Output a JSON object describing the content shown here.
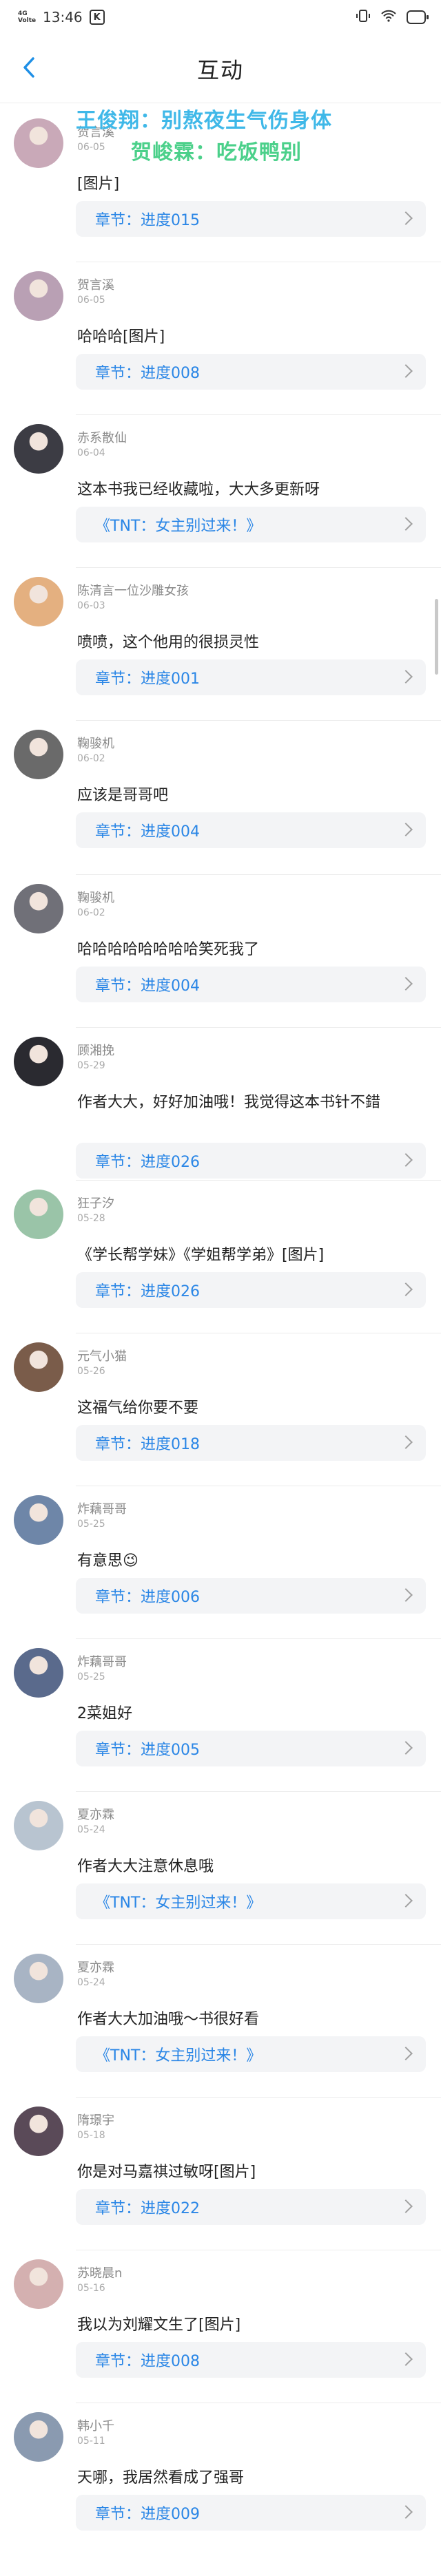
{
  "status_bar": {
    "time": "13:46",
    "net_badge": "4G\nVolte",
    "sq_badge": "K",
    "battery_icon": "battery-icon",
    "wifi_icon": "wifi-icon",
    "vibrate_icon": "vibrate-icon"
  },
  "header": {
    "title": "互动",
    "back_icon": "chevron-left-icon"
  },
  "overlay": {
    "line1": "王俊翔：别熬夜生气伤身体",
    "line2": "贺峻霖：吃饭鸭别"
  },
  "comments": [
    {
      "user": "贺言溪",
      "date": "06-05",
      "text": "[图片]",
      "chapter": "章节：进度015",
      "accent": "#2a86e6"
    },
    {
      "user": "贺言溪",
      "date": "06-05",
      "text": "哈哈哈[图片]",
      "chapter": "章节：进度008",
      "accent": "#2a86e6"
    },
    {
      "user": "赤系散仙",
      "date": "06-04",
      "text": "这本书我已经收藏啦，大大多更新呀",
      "chapter": "《TNT：女主别过来！》",
      "accent": "#2a86e6"
    },
    {
      "user": "陈清言一位沙雕女孩",
      "date": "06-03",
      "text": "喷喷，这个他用的很损灵性",
      "chapter": "章节：进度001",
      "accent": "#2a86e6"
    },
    {
      "user": "鞠骏机",
      "date": "06-02",
      "text": "应该是哥哥吧",
      "chapter": "章节：进度004",
      "accent": "#2a86e6"
    },
    {
      "user": "鞠骏机",
      "date": "06-02",
      "text": "哈哈哈哈哈哈哈哈笑死我了",
      "chapter": "章节：进度004",
      "accent": "#2a86e6"
    },
    {
      "user": "顾湘挽",
      "date": "05-29",
      "text": "作者大大，好好加油哦！我觉得这本书针不錯",
      "chapter": "章节：进度026",
      "accent": "#2a86e6"
    },
    {
      "user": "狂子汐",
      "date": "05-28",
      "text": "《学长帮学妹》《学姐帮学弟》[图片]",
      "chapter": "章节：进度026",
      "accent": "#2a86e6"
    },
    {
      "user": "元气小猫",
      "date": "05-26",
      "text": "这福气给你要不要",
      "chapter": "章节：进度018",
      "accent": "#2a86e6"
    },
    {
      "user": "炸藕哥哥",
      "date": "05-25",
      "text": "有意思😉",
      "chapter": "章节：进度006",
      "accent": "#2a86e6"
    },
    {
      "user": "炸藕哥哥",
      "date": "05-25",
      "text": "2菜姐好",
      "chapter": "章节：进度005",
      "accent": "#2a86e6"
    },
    {
      "user": "夏亦霖",
      "date": "05-24",
      "text": "作者大大注意休息哦",
      "chapter": "《TNT：女主别过来！》",
      "accent": "#2a86e6"
    },
    {
      "user": "夏亦霖",
      "date": "05-24",
      "text": "作者大大加油哦～书很好看",
      "chapter": "《TNT：女主别过来！》",
      "accent": "#2a86e6"
    },
    {
      "user": "隋璟宇",
      "date": "05-18",
      "text": "你是对马嘉祺过敏呀[图片]",
      "chapter": "章节：进度022",
      "accent": "#2a86e6"
    },
    {
      "user": "苏晓晨n",
      "date": "05-16",
      "text": "我以为刘耀文生了[图片]",
      "chapter": "章节：进度008",
      "accent": "#2a86e6"
    },
    {
      "user": "韩小千",
      "date": "05-11",
      "text": "天哪，我居然看成了强哥",
      "chapter": "章节：进度009",
      "accent": "#2a86e6"
    }
  ],
  "icons": {
    "chevron": "chevron-right-icon"
  }
}
